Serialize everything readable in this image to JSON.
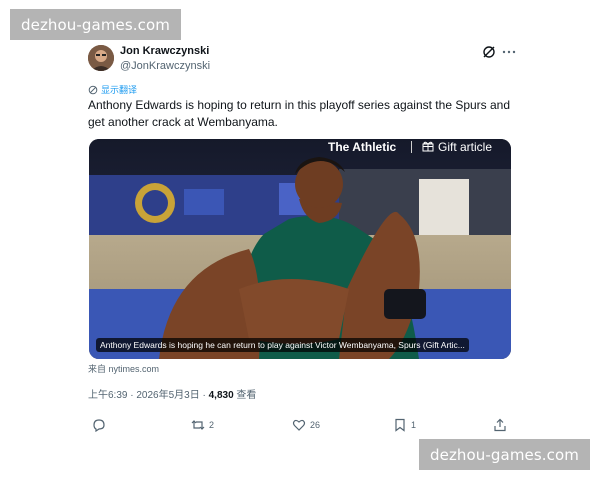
{
  "watermark": {
    "top": "dezhou-games.com",
    "bottom": "dezhou-games.com"
  },
  "author": {
    "name": "Jon Krawczynski",
    "handle": "@JonKrawczynski"
  },
  "translate_label": "显示翻译",
  "tweet_text": "Anthony Edwards is hoping to return in this playoff series against the Spurs and get another crack at Wembanyama.",
  "media": {
    "brand": "The Athletic",
    "gift_label": "Gift article",
    "caption": "Anthony Edwards is hoping he can return to play against Victor Wembanyama, Spurs (Gift Artic..."
  },
  "source": "来自 nytimes.com",
  "meta": {
    "time": "上午6:39 · 2026年5月3日 · ",
    "views": "4,830",
    "views_label": " 查看"
  },
  "actions": {
    "reply_count": "",
    "retweet_count": "2",
    "like_count": "26",
    "bookmark_count": "1"
  },
  "colors": {
    "accent": "#1d9bf0",
    "muted": "#536471",
    "text": "#0f1419"
  },
  "icons": [
    "grok-icon",
    "more-icon",
    "translate-icon",
    "gift-icon",
    "reply-icon",
    "retweet-icon",
    "like-icon",
    "bookmark-icon",
    "share-icon"
  ]
}
